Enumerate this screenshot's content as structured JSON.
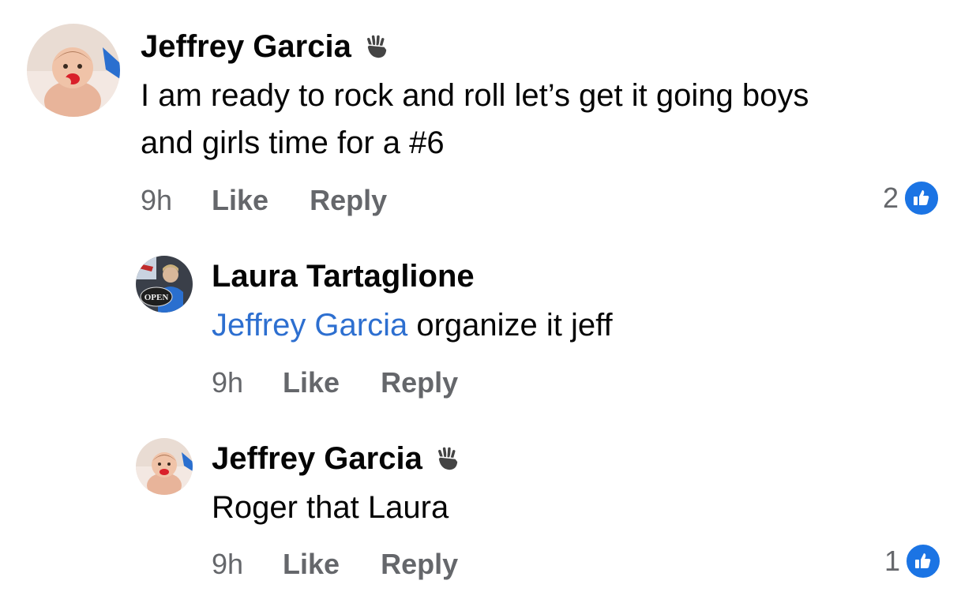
{
  "comments": [
    {
      "author": "Jeffrey Garcia",
      "badge_icon": "waving-hand-icon",
      "text_line1": "I am ready to rock and roll let’s get it going boys",
      "text_line2": "and girls time for a #6",
      "time": "9h",
      "like_label": "Like",
      "reply_label": "Reply",
      "reaction_count": "2",
      "reaction_icon": "thumbs-up-icon"
    },
    {
      "author": "Laura Tartaglione",
      "avatar_sign": "OPEN",
      "mention": "Jeffrey Garcia",
      "text": " organize it jeff",
      "time": "9h",
      "like_label": "Like",
      "reply_label": "Reply"
    },
    {
      "author": "Jeffrey Garcia",
      "badge_icon": "waving-hand-icon",
      "text": "Roger that Laura",
      "time": "9h",
      "like_label": "Like",
      "reply_label": "Reply",
      "reaction_count": "1",
      "reaction_icon": "thumbs-up-icon"
    }
  ],
  "colors": {
    "mention": "#2d6fd0",
    "meta_gray": "#65676b",
    "like_blue": "#1b74e4"
  }
}
